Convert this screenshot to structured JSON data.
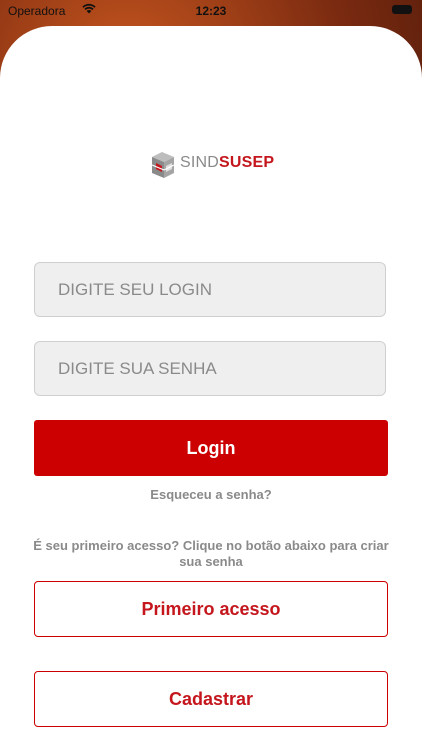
{
  "status_bar": {
    "carrier": "Operadora",
    "time": "12:23"
  },
  "logo": {
    "part1": "SIND",
    "part2": "SUSEP"
  },
  "login_form": {
    "login_placeholder": "DIGITE SEU LOGIN",
    "password_placeholder": "DIGITE SUA SENHA",
    "login_button": "Login",
    "forgot_password": "Esqueceu a senha?"
  },
  "first_access": {
    "hint": "É seu primeiro acesso? Clique no botão abaixo para criar sua senha",
    "button": "Primeiro acesso"
  },
  "register": {
    "button": "Cadastrar"
  },
  "colors": {
    "accent": "#cc0000",
    "text_muted": "#8a8a8a",
    "field_bg": "#efefef"
  }
}
